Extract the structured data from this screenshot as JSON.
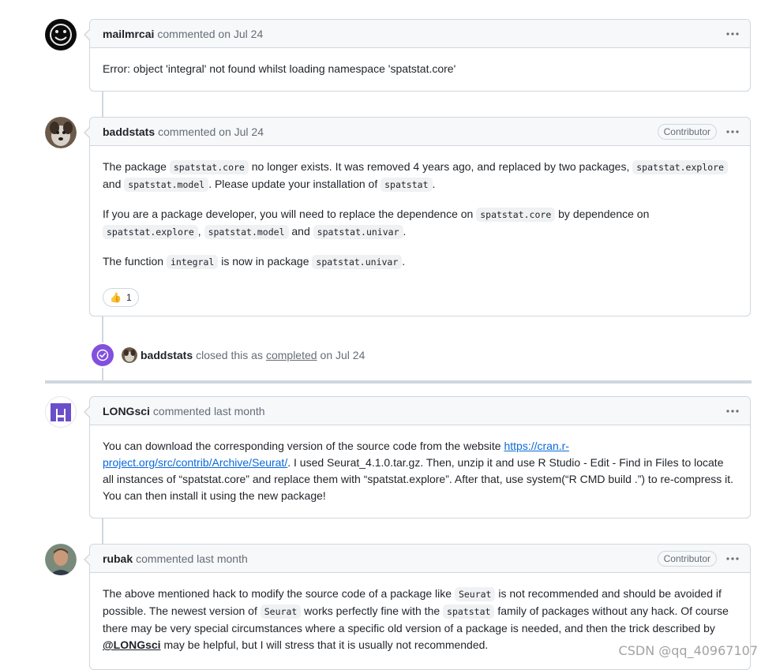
{
  "comments": [
    {
      "author": "mailmrcai",
      "meta": "commented on Jul 24",
      "body": "Error: object 'integral' not found whilst loading namespace 'spatstat.core'"
    },
    {
      "author": "baddstats",
      "meta": "commented on Jul 24",
      "badge": "Contributor",
      "p1": {
        "t1": "The package ",
        "c1": "spatstat.core",
        "t2": " no longer exists. It was removed 4 years ago, and replaced by two packages, ",
        "c2": "spatstat.explore",
        "t3": " and ",
        "c3": "spatstat.model",
        "t4": ". Please update your installation of ",
        "c4": "spatstat",
        "t5": "."
      },
      "p2": {
        "t1": "If you are a package developer, you will need to replace the dependence on ",
        "c1": "spatstat.core",
        "t2": " by dependence on ",
        "c2": "spatstat.explore",
        "t3": ",",
        "c3": "spatstat.model",
        "t4": " and ",
        "c4": "spatstat.univar",
        "t5": "."
      },
      "p3": {
        "t1": "The function ",
        "c1": "integral",
        "t2": " is now in package ",
        "c2": "spatstat.univar",
        "t3": "."
      },
      "reaction": {
        "emoji": "👍",
        "count": "1"
      }
    },
    {
      "author": "LONGsci",
      "meta": "commented last month",
      "t1": "You can download the corresponding version of the source code from the website ",
      "link": "https://cran.r-project.org/src/contrib/Archive/Seurat/",
      "t2": ". I used Seurat_4.1.0.tar.gz. Then, unzip it and use R Studio - Edit - Find in Files to locate all instances of “spatstat.core” and replace them with “spatstat.explore”. After that, use system(“R CMD build .”) to re-compress it. You can then install it using the new package!"
    },
    {
      "author": "rubak",
      "meta": "commented last month",
      "badge": "Contributor",
      "t1": "The above mentioned hack to modify the source code of a package like ",
      "c1": "Seurat",
      "t2": " is not recommended and should be avoided if possible. The newest version of ",
      "c2": "Seurat",
      "t3": " works perfectly fine with the ",
      "c3": "spatstat",
      "t4": " family of packages without any hack. Of course there may be very special circumstances where a specific old version of a package is needed, and then the trick described by ",
      "mention": "@LONGsci",
      "t5": " may be helpful, but I will stress that it is usually not recommended."
    }
  ],
  "event": {
    "actor": "baddstats",
    "text1": "closed this as",
    "link": "completed",
    "text2": "on Jul 24"
  },
  "watermark": "CSDN @qq_40967107",
  "colors": {
    "event_badge": "#8250df",
    "link": "#0969da",
    "border": "#d0d7de"
  }
}
